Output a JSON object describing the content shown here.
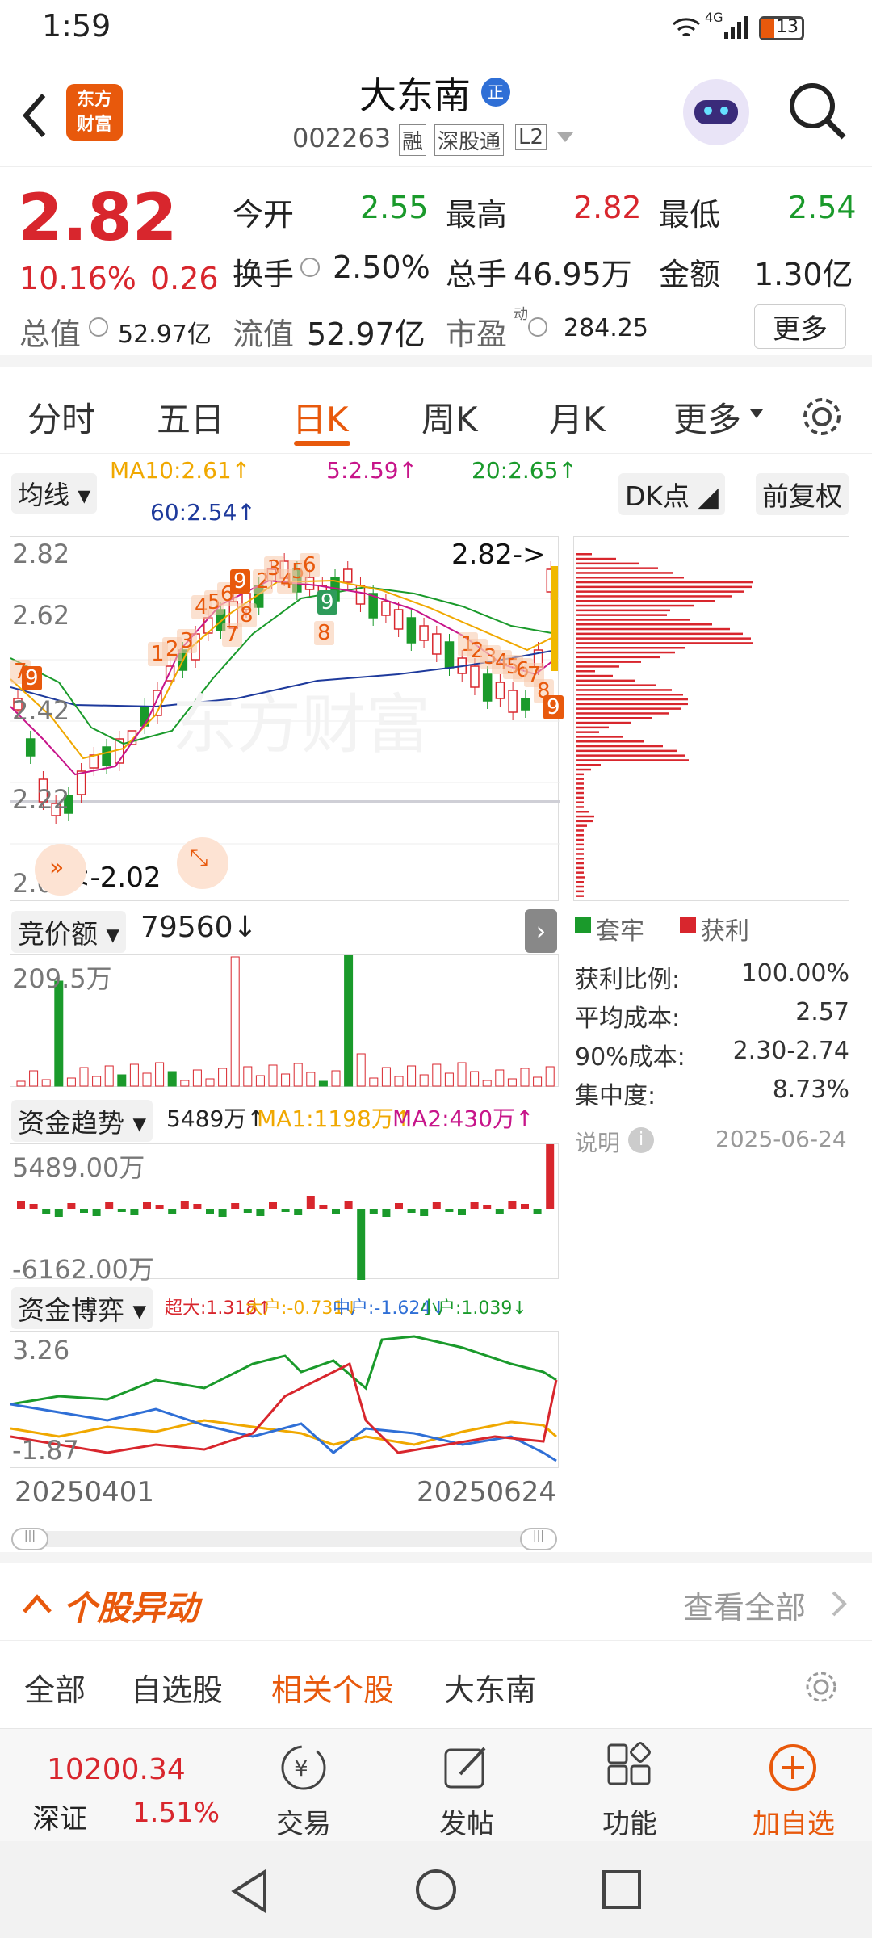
{
  "status": {
    "time": "1:59",
    "network": "4G",
    "battery": "13"
  },
  "header": {
    "logo_line1": "东方",
    "logo_line2": "财富",
    "title": "大东南",
    "title_badge": "正",
    "code": "002263",
    "tags": [
      "融",
      "深股通",
      "L2"
    ]
  },
  "quote": {
    "price": "2.82",
    "change_pct": "10.16%",
    "change": "0.26",
    "open_label": "今开",
    "open": "2.55",
    "high_label": "最高",
    "high": "2.82",
    "low_label": "最低",
    "low": "2.54",
    "turnover_label": "换手",
    "turnover": "2.50%",
    "volume_label": "总手",
    "volume": "46.95万",
    "amount_label": "金额",
    "amount": "1.30亿",
    "mktcap_label": "总值",
    "mktcap": "52.97亿",
    "float_label": "流值",
    "float": "52.97亿",
    "pe_label": "市盈",
    "pe_sup": "动",
    "pe": "284.25",
    "more": "更多"
  },
  "tabs": [
    "分时",
    "五日",
    "日K",
    "周K",
    "月K",
    "更多"
  ],
  "ma": {
    "selector": "均线",
    "ma10": "MA10:2.61↑",
    "ma5": "5:2.59↑",
    "ma20": "20:2.65↑",
    "ma60": "60:2.54↑",
    "dk": "DK点",
    "fq": "前复权"
  },
  "kline": {
    "y_labels": [
      "2.82",
      "2.62",
      "2.42",
      "2.22",
      "2.02"
    ],
    "last_price_tag": "2.82->",
    "low_tag": "<-2.02",
    "watermark": "东方财富",
    "signals": [
      "7",
      "9",
      "1",
      "2",
      "3",
      "4",
      "5",
      "6",
      "7",
      "8",
      "9",
      "2",
      "3",
      "4",
      "5",
      "6",
      "9",
      "8",
      "1",
      "2",
      "3",
      "4",
      "5",
      "6",
      "7",
      "8",
      "9"
    ]
  },
  "chip": {
    "trapped_label": "套牢",
    "profit_label": "获利",
    "rows": [
      {
        "k": "获利比例:",
        "v": "100.00%"
      },
      {
        "k": "平均成本:",
        "v": "2.57"
      },
      {
        "k": "90%成本:",
        "v": "2.30-2.74"
      },
      {
        "k": "集中度:",
        "v": "8.73%"
      }
    ],
    "note": "说明",
    "date": "2025-06-24"
  },
  "auction": {
    "selector": "竞价额",
    "value": "79560↓",
    "ymax": "209.5万"
  },
  "flow": {
    "selector": "资金趋势",
    "value": "5489万↑",
    "ma1": "MA1:1198万↑",
    "ma2": "MA2:430万↑",
    "ymax": "5489.00万",
    "ymin": "-6162.00万"
  },
  "game": {
    "selector": "资金博弈",
    "super": "超大:1.318↑",
    "big": "大户:-0.731↓",
    "mid": "中户:-1.624↓",
    "small": "小户:1.039↓",
    "ymax": "3.26",
    "ymin": "-1.87"
  },
  "xaxis": {
    "start": "20250401",
    "end": "20250624"
  },
  "anomaly": {
    "title": "个股异动",
    "view_all": "查看全部",
    "tabs": [
      "全部",
      "自选股",
      "相关个股",
      "大东南"
    ]
  },
  "bottom": {
    "index_value": "10200.34",
    "index_name": "深证",
    "index_pct": "1.51%",
    "trade": "交易",
    "post": "发帖",
    "func": "功能",
    "add": "加自选"
  },
  "colors": {
    "red": "#d8262d",
    "green": "#1a9a2b",
    "orange": "#e8590c"
  }
}
